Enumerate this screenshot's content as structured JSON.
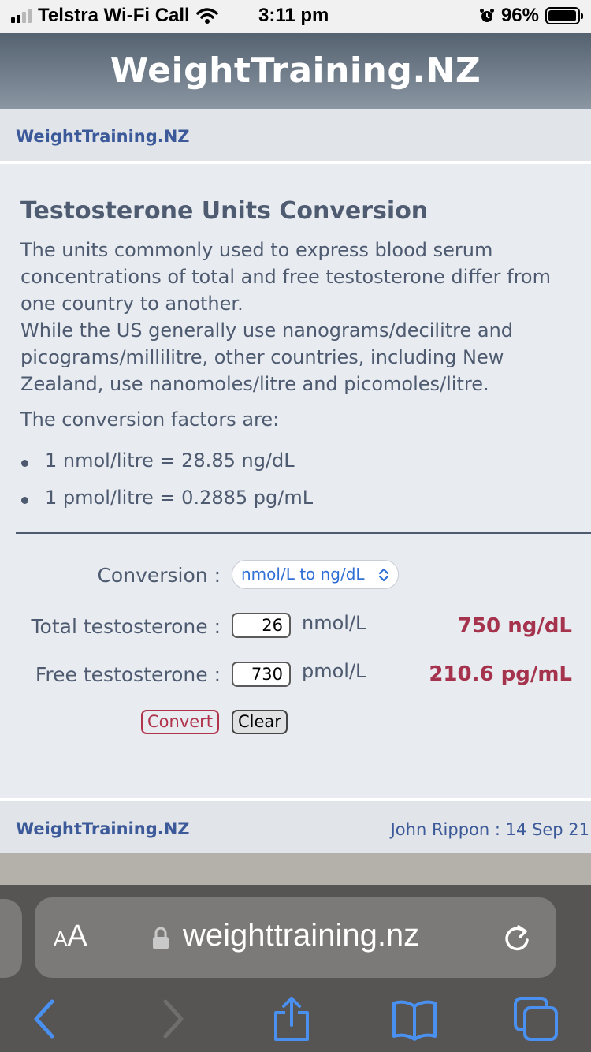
{
  "status_bar": {
    "carrier": "Telstra Wi-Fi Call",
    "time": "3:11 pm",
    "battery": "96%"
  },
  "header": {
    "title": "WeightTraining.NZ"
  },
  "breadcrumb": {
    "site_link": "WeightTraining.NZ"
  },
  "main": {
    "heading": "Testosterone Units Conversion",
    "intro_1": "The units commonly used to express blood serum concentrations of total and free testosterone differ from one country to another.",
    "intro_2": "While the US generally use nanograms/decilitre and picograms/millilitre, other countries, including New Zealand, use nanomoles/litre and picomoles/litre.",
    "factors_title": "The conversion factors are:",
    "factors": [
      "1 nmol/litre = 28.85 ng/dL",
      "1 pmol/litre = 0.2885 pg/mL"
    ]
  },
  "form": {
    "conversion_label": "Conversion :",
    "conversion_value": "nmol/L to ng/dL",
    "total_label": "Total testosterone :",
    "total_value": "26",
    "total_unit": "nmol/L",
    "total_result": "750 ng/dL",
    "free_label": "Free testosterone :",
    "free_value": "730",
    "free_unit": "pmol/L",
    "free_result": "210.6 pg/mL",
    "convert_label": "Convert",
    "clear_label": "Clear"
  },
  "footer": {
    "site_link": "WeightTraining.NZ",
    "credit": "John Rippon : 14 Sep 21"
  },
  "browser": {
    "aa_small": "A",
    "aa_big": "A",
    "url": "weighttraining.nz"
  },
  "colors": {
    "accent_link": "#3c5a99",
    "result": "#a5334d",
    "header_gradient_top": "#556270"
  }
}
